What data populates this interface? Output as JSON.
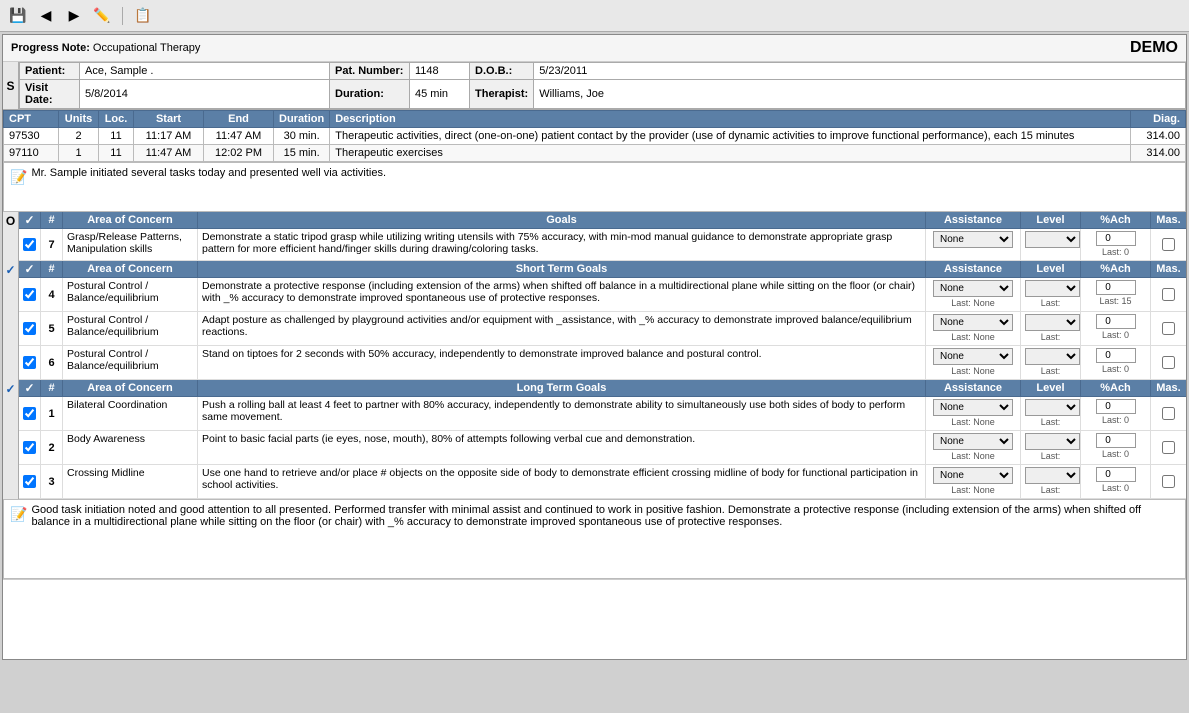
{
  "toolbar": {
    "icons": [
      "save",
      "back",
      "forward",
      "pencil",
      "separator",
      "export"
    ]
  },
  "header": {
    "progress_note_label": "Progress Note:",
    "progress_note_type": "Occupational Therapy",
    "demo": "DEMO"
  },
  "patient": {
    "label": "Patient:",
    "name": "Ace, Sample .",
    "pat_number_label": "Pat. Number:",
    "pat_number": "1148",
    "dob_label": "D.O.B.:",
    "dob": "5/23/2011",
    "visit_date_label": "Visit Date:",
    "visit_date": "5/8/2014",
    "duration_label": "Duration:",
    "duration": "45 min",
    "therapist_label": "Therapist:",
    "therapist": "Williams, Joe"
  },
  "cpt_table": {
    "headers": [
      "CPT",
      "Units",
      "Loc.",
      "Start",
      "End",
      "Duration",
      "Description",
      "Diag."
    ],
    "rows": [
      {
        "cpt": "97530",
        "units": "2",
        "loc": "11",
        "start": "11:17 AM",
        "end": "11:47 AM",
        "duration": "30 min.",
        "description": "Therapeutic activities, direct (one-on-one) patient contact by the provider (use of dynamic activities to improve functional performance), each 15 minutes",
        "diag": "314.00"
      },
      {
        "cpt": "97110",
        "units": "1",
        "loc": "11",
        "start": "11:47 AM",
        "end": "12:02 PM",
        "duration": "15 min.",
        "description": "Therapeutic exercises",
        "diag": "314.00"
      }
    ]
  },
  "session_note": "Mr. Sample initiated several tasks today and presented well via activities.",
  "long_term_header": "Long Term Goals",
  "short_term_header": "Short Term Goals",
  "goals_columns": {
    "hash": "#",
    "area": "Area of Concern",
    "goals": "Goals",
    "assistance": "Assistance",
    "level": "Level",
    "pct_ach": "%Ach",
    "mas": "Mas."
  },
  "long_term_section": {
    "goal_row_lt": {
      "number": "7",
      "area": "Grasp/Release Patterns, Manipulation skills",
      "goal": "Demonstrate a static tripod grasp while utilizing writing utensils with 75% accuracy, with min-mod manual guidance to demonstrate appropriate grasp pattern for more efficient hand/finger skills during drawing/coloring tasks.",
      "assistance": "None",
      "assistance_last": "",
      "level": "",
      "level_last": "",
      "pct": "0",
      "pct_last": "Last: 0",
      "mas": false
    }
  },
  "short_term_rows": [
    {
      "number": "4",
      "area": "Postural Control / Balance/equilibrium",
      "goal": "Demonstrate a protective response (including extension of the arms) when shifted off balance in a multidirectional plane while sitting on the floor (or chair) with _% accuracy to demonstrate improved spontaneous use of protective responses.",
      "assistance": "None",
      "assistance_last": "Last: None",
      "level": "",
      "level_last": "Last:",
      "pct": "0",
      "pct_last": "Last: 15",
      "mas": false
    },
    {
      "number": "5",
      "area": "Postural Control / Balance/equilibrium",
      "goal": "Adapt posture as challenged by playground activities and/or equipment with _assistance, with _% accuracy to demonstrate improved balance/equilibrium reactions.",
      "assistance": "None",
      "assistance_last": "Last: None",
      "level": "",
      "level_last": "Last:",
      "pct": "0",
      "pct_last": "Last: 0",
      "mas": false
    },
    {
      "number": "6",
      "area": "Postural Control / Balance/equilibrium",
      "goal": "Stand on tiptoes for 2 seconds with 50% accuracy, independently to demonstrate improved balance and postural control.",
      "assistance": "None",
      "assistance_last": "Last: None",
      "level": "",
      "level_last": "Last:",
      "pct": "0",
      "pct_last": "Last: 0",
      "mas": false
    }
  ],
  "long_term_goals_rows": [
    {
      "number": "1",
      "area": "Bilateral Coordination",
      "goal": "Push a rolling ball at least 4 feet to partner with 80% accuracy, independently to demonstrate ability to simultaneously use both sides of body to perform same movement.",
      "assistance": "None",
      "assistance_last": "Last: None",
      "level": "",
      "level_last": "Last:",
      "pct": "0",
      "pct_last": "Last: 0",
      "mas": false
    },
    {
      "number": "2",
      "area": "Body Awareness",
      "goal": "Point to basic facial parts (ie eyes, nose, mouth), 80% of attempts following verbal cue and demonstration.",
      "assistance": "None",
      "assistance_last": "Last: None",
      "level": "",
      "level_last": "Last:",
      "pct": "0",
      "pct_last": "Last: 0",
      "mas": false
    },
    {
      "number": "3",
      "area": "Crossing Midline",
      "goal": "Use one hand to retrieve and/or place # objects on the opposite side of body to demonstrate efficient crossing midline of body for functional participation in school activities.",
      "assistance": "None",
      "assistance_last": "Last: None",
      "level": "",
      "level_last": "Last:",
      "pct": "0",
      "pct_last": "Last: 0",
      "mas": false
    }
  ],
  "bottom_note": "Good task initiation noted and good attention to all presented.  Performed transfer with minimal assist and continued to work in positive fashion.  Demonstrate a protective response (including extension of the arms) when shifted off balance in a multidirectional plane while sitting on the floor (or chair) with _% accuracy to demonstrate improved spontaneous use of protective responses."
}
